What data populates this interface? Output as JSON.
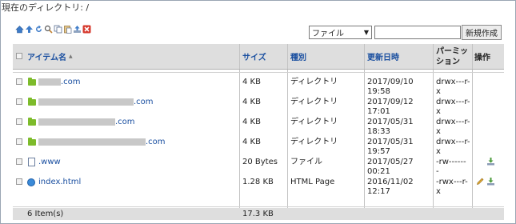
{
  "header": {
    "current_dir": "現在のディレクトリ: /"
  },
  "toolbar": {
    "icons": [
      "home-icon",
      "up-arrow-icon",
      "refresh-icon",
      "search-icon",
      "copy-icon",
      "paste-icon",
      "upload-icon",
      "delete-icon"
    ]
  },
  "filter": {
    "selected": "ファイル",
    "arrow": "▼"
  },
  "search": {
    "value": "",
    "placeholder": ""
  },
  "new_button": "新規作成",
  "columns": {
    "name": "アイテム名",
    "sort_indicator": "▲",
    "size": "サイズ",
    "type": "種別",
    "modified": "更新日時",
    "permission_line1": "パーミッ",
    "permission_line2": "ション",
    "actions": "操作"
  },
  "rows": [
    {
      "name": ".com",
      "size": "4 KB",
      "type": "ディレクトリ",
      "date": "2017/09/10",
      "time": "19:58",
      "perm1": "drwx---r-",
      "perm2": "x",
      "icon": "folder-icon"
    },
    {
      "name": ".com",
      "size": "4 KB",
      "type": "ディレクトリ",
      "date": "2017/09/12",
      "time": "17:01",
      "perm1": "drwx---r-",
      "perm2": "x",
      "icon": "folder-icon"
    },
    {
      "name": ".com",
      "size": "4 KB",
      "type": "ディレクトリ",
      "date": "2017/05/31",
      "time": "18:33",
      "perm1": "drwx---r-",
      "perm2": "x",
      "icon": "folder-icon"
    },
    {
      "name": ".com",
      "size": "4 KB",
      "type": "ディレクトリ",
      "date": "2017/05/31",
      "time": "19:57",
      "perm1": "drwx---r-",
      "perm2": "x",
      "icon": "folder-icon"
    },
    {
      "name": ".www",
      "size": "20 Bytes",
      "type": "ファイル",
      "date": "2017/05/27",
      "time": "00:21",
      "perm1": "-rw------",
      "perm2": "-",
      "icon": "file-icon"
    },
    {
      "name": "index.html",
      "size": "1.28 KB",
      "type": "HTML Page",
      "date": "2016/11/02",
      "time": "12:17",
      "perm1": "-rwx---r-",
      "perm2": "x",
      "icon": "html-icon"
    }
  ],
  "footer": {
    "count": "6 Item(s)",
    "total_size": "17.3 KB"
  },
  "colors": {
    "link": "#1a4fa0",
    "header_bg": "#dedede",
    "folder": "#7dbb2b"
  }
}
